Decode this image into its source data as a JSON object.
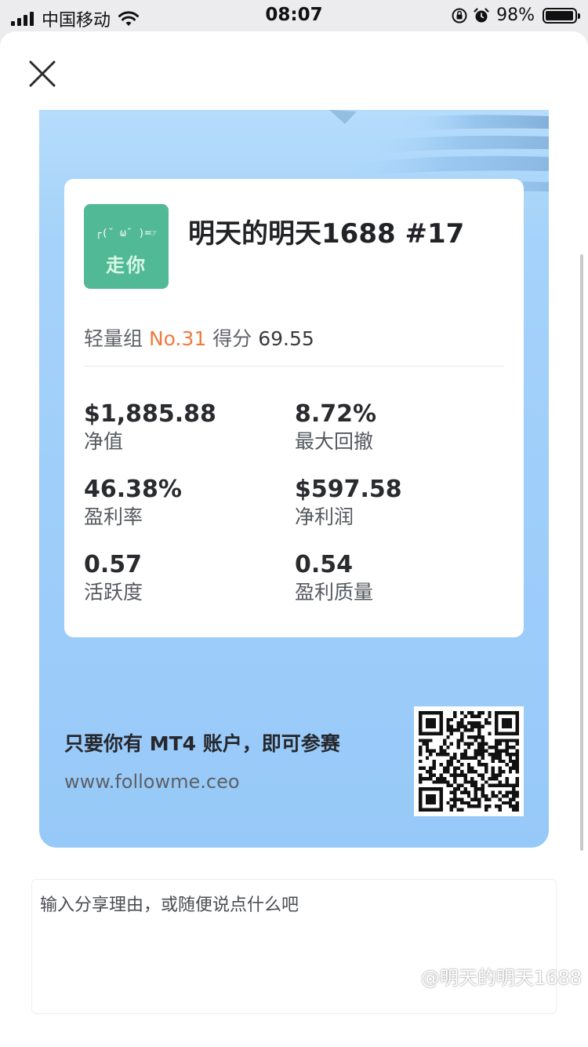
{
  "status_bar": {
    "carrier": "中国移动",
    "time": "08:07",
    "battery_percent": "98%",
    "battery_level": 0.98
  },
  "poster": {
    "avatar": {
      "face": "┌(˘ ω˘ )=☞",
      "text": "走你",
      "color": "#52b996"
    },
    "user_title": "明天的明天1688  #17",
    "rank": {
      "group": "轻量组",
      "number": "No.31",
      "score_label": "得分",
      "score": "69.55"
    },
    "stats": [
      {
        "value": "$1,885.88",
        "label": "净值"
      },
      {
        "value": "8.72%",
        "label": "最大回撤"
      },
      {
        "value": "46.38%",
        "label": "盈利率"
      },
      {
        "value": "$597.58",
        "label": "净利润"
      },
      {
        "value": "0.57",
        "label": "活跃度"
      },
      {
        "value": "0.54",
        "label": "盈利质量"
      }
    ],
    "promo_text": "只要你有 MT4 账户，即可参赛",
    "promo_url": "www.followme.ceo"
  },
  "share": {
    "placeholder": "输入分享理由，或随便说点什么吧"
  },
  "watermark": "@明天的明天1688",
  "colors": {
    "accent_orange": "#ee7b3e",
    "poster_blue": "#9ecdfa"
  }
}
